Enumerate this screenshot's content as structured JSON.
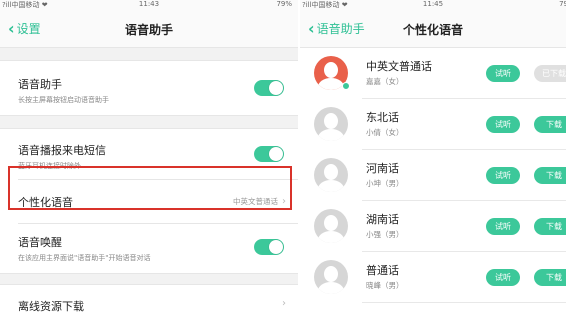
{
  "left": {
    "status": {
      "carrier": "?ill中国移动 ❤",
      "time": "11:43",
      "battery": "79%"
    },
    "nav": {
      "back": "设置",
      "title": "语音助手"
    },
    "assistant": {
      "label": "语音助手",
      "sub": "长按主屏幕按钮启动语音助手"
    },
    "sms": {
      "label": "语音播报来电短信",
      "sub": "蓝牙耳机连接时除外"
    },
    "personal": {
      "label": "个性化语音",
      "value": "中英文普通话"
    },
    "wake": {
      "label": "语音唤醒",
      "sub": "在该应用主界面说\"语音助手\"开始语音对话"
    },
    "offline": {
      "label": "离线资源下载"
    }
  },
  "right": {
    "status": {
      "carrier": "?ill中国移动 ❤",
      "time": "11:45",
      "battery": "79"
    },
    "nav": {
      "back": "语音助手",
      "title": "个性化语音"
    },
    "try_label": "试听",
    "download_label": "下载",
    "downloaded_label": "已下载",
    "voices": [
      {
        "name": "中英文普通话",
        "speaker": "嘉嘉（女）"
      },
      {
        "name": "东北话",
        "speaker": "小倩（女）"
      },
      {
        "name": "河南话",
        "speaker": "小坤（男）"
      },
      {
        "name": "湖南话",
        "speaker": "小强（男）"
      },
      {
        "name": "普通话",
        "speaker": "晓峰（男）"
      }
    ]
  },
  "colors": {
    "accent": "#3cc89a",
    "back_text": "#2fc095",
    "highlight": "#d9322a",
    "active_avatar": "#e9604a"
  },
  "icons": {
    "toggle_state": "on",
    "avatar": "person-silhouette-icon",
    "chevron": "chevron-right-icon"
  }
}
